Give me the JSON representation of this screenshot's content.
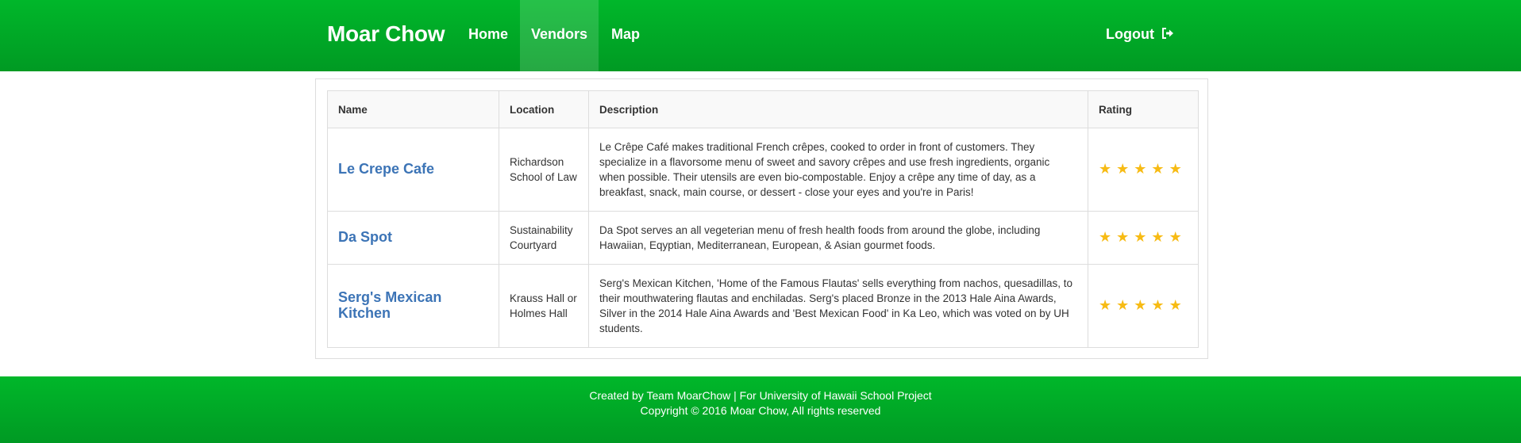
{
  "navbar": {
    "brand": "Moar Chow",
    "items": [
      {
        "label": "Home"
      },
      {
        "label": "Vendors",
        "active": true
      },
      {
        "label": "Map"
      }
    ],
    "logout_label": "Logout",
    "logout_icon": "sign-out-icon",
    "color": "#00b72a"
  },
  "table": {
    "headers": [
      "Name",
      "Location",
      "Description",
      "Rating"
    ],
    "rows": [
      {
        "name": "Le Crepe Cafe",
        "location": "Richardson School of Law",
        "description": "Le Crêpe Café makes traditional French crêpes, cooked to order in front of customers. They specialize in a flavorsome menu of sweet and savory crêpes and use fresh ingredients, organic when possible. Their utensils are even bio-compostable. Enjoy a crêpe any time of day, as a breakfast, snack, main course, or dessert - close your eyes and you're in Paris!",
        "rating": 5
      },
      {
        "name": "Da Spot",
        "location": "Sustainability Courtyard",
        "description": "Da Spot serves an all vegeterian menu of fresh health foods from around the globe, including Hawaiian, Eqyptian, Mediterranean, European, & Asian gourmet foods.",
        "rating": 5
      },
      {
        "name": "Serg's Mexican Kitchen",
        "location": "Krauss Hall or Holmes Hall",
        "description": "Serg's Mexican Kitchen, 'Home of the Famous Flautas' sells everything from nachos, quesadillas, to their mouthwatering flautas and enchiladas. Serg's placed Bronze in the 2013 Hale Aina Awards, Silver in the 2014 Hale Aina Awards and 'Best Mexican Food' in Ka Leo, which was voted on by UH students.",
        "rating": 5
      }
    ],
    "star_icon": "star-icon",
    "star_color": "#f7bb14",
    "link_color": "#3c74b6"
  },
  "footer": {
    "line1": "Created by Team MoarChow | For University of Hawaii School Project",
    "line2": "Copyright © 2016 Moar Chow, All rights reserved"
  }
}
